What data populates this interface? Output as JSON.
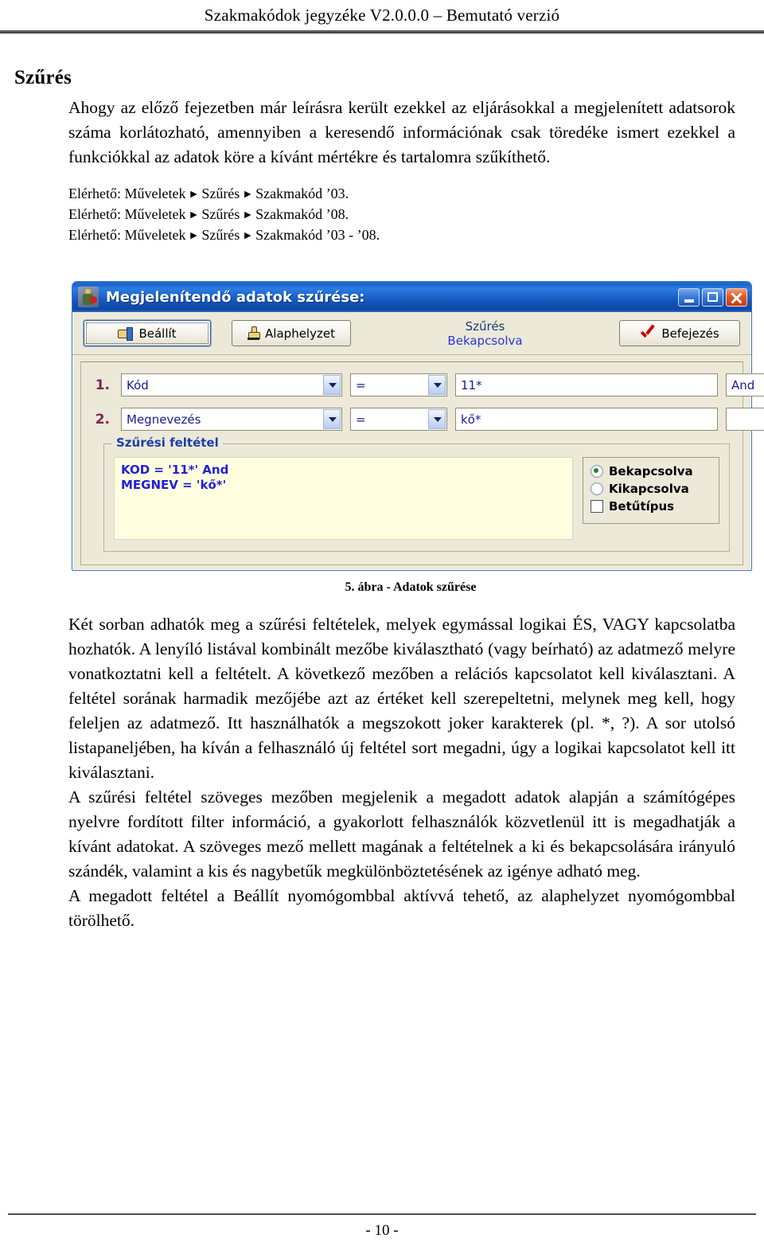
{
  "header": {
    "running_title": "Szakmakódok jegyzéke V2.0.0.0 – Bemutató verzió"
  },
  "section": {
    "title": "Szűrés",
    "intro_paragraph": "Ahogy az előző fejezetben már leírásra került ezekkel az eljárásokkal a megjelenített adatsorok száma korlátozható, amennyiben a keresendő információnak csak töredéke ismert ezekkel a funkciókkal az adatok köre a kívánt mértékre és tartalomra szűkíthető."
  },
  "access_lines": [
    {
      "prefix": "Elérhető: Műveletek",
      "level1": "Szűrés",
      "level2": "Szakmakód ’03."
    },
    {
      "prefix": "Elérhető: Műveletek",
      "level1": "Szűrés",
      "level2": "Szakmakód ’08."
    },
    {
      "prefix": "Elérhető: Műveletek",
      "level1": "Szűrés",
      "level2": "Szakmakód ’03 - ’08."
    }
  ],
  "figure": {
    "caption": "5. ábra - Adatok szűrése",
    "dialog": {
      "title": "Megjelenítendő adatok szűrése:",
      "app_icon": "person-figure-icon",
      "window_buttons": {
        "minimize": "minimize-icon",
        "maximize": "maximize-icon",
        "close": "close-icon"
      },
      "toolbar": {
        "set_label": "Beállít",
        "reset_label": "Alaphelyzet",
        "status_title": "Szűrés",
        "status_value": "Bekapcsolva",
        "finish_label": "Befejezés"
      },
      "conditions": [
        {
          "number": "1.",
          "field": "Kód",
          "operator": "=",
          "value": "11*",
          "logic": "And"
        },
        {
          "number": "2.",
          "field": "Megnevezés",
          "operator": "=",
          "value": "kő*",
          "logic": ""
        }
      ],
      "groupbox": {
        "legend": "Szűrési feltétel",
        "expression": "KOD = '11*' And\nMEGNEV = 'kő*'",
        "options": {
          "enabled_label": "Bekapcsolva",
          "disabled_label": "Kikapcsolva",
          "font_label": "Betűtípus"
        }
      }
    }
  },
  "body_paragraphs": [
    "Két sorban adhatók meg a szűrési feltételek, melyek egymással logikai ÉS, VAGY kapcsolatba hozhatók. A lenyíló listával kombinált mezőbe kiválasztható (vagy beírható) az adatmező melyre vonatkoztatni kell a feltételt. A következő mezőben a relációs kapcsolatot kell kiválasztani. A feltétel sorának harmadik mezőjébe azt az értéket kell szerepeltetni, melynek meg kell, hogy feleljen az adatmező. Itt használhatók a megszokott joker karakterek (pl. *, ?). A sor utolsó listapaneljében, ha kíván a felhasználó új feltétel sort megadni, úgy a logikai kapcsolatot kell itt kiválasztani.",
    "A szűrési feltétel szöveges mezőben megjelenik a megadott adatok alapján a számítógépes nyelvre fordított filter információ, a gyakorlott felhasználók közvetlenül itt is megadhatják a kívánt adatokat. A szöveges mező mellett magának a feltételnek a ki és bekapcsolására irányuló szándék, valamint a kis és nagybetűk megkülönböztetésének az igénye adható meg.",
    "A megadott feltétel a Beállít nyomógombbal aktívvá tehető, az alaphelyzet nyomógombbal törölhető."
  ],
  "footer": {
    "page_number": "- 10 -"
  },
  "colors": {
    "titlebar_blue": "#1556bd",
    "status_blue": "#2a36d8",
    "expression_blue": "#2020d8",
    "row_number_maroon": "#7b2551",
    "dialog_face": "#ece9d8",
    "filter_field_yellow": "#ffffe0",
    "radio_green": "#1f8a1f",
    "check_red": "#cc0000"
  }
}
